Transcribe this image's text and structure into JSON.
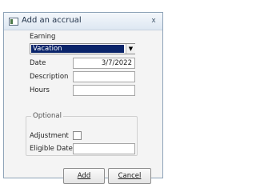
{
  "window": {
    "title": "Add an accrual",
    "close_glyph": "x"
  },
  "earning": {
    "label": "Earning",
    "value": "Vacation",
    "arrow_glyph": "▼"
  },
  "date": {
    "label": "Date",
    "value": "3/7/2022"
  },
  "description": {
    "label": "Description",
    "value": ""
  },
  "hours": {
    "label": "Hours",
    "value": ""
  },
  "optional": {
    "title": "Optional",
    "adjustment_label": "Adjustment",
    "adjustment_checked": false,
    "eligible_date_label": "Eligible Date",
    "eligible_date_value": ""
  },
  "buttons": {
    "add": "Add",
    "cancel": "Cancel"
  },
  "colors": {
    "selection": "#0a246a",
    "accent": "#4d7a4a"
  },
  "icons": {
    "window": "app-window-icon",
    "close": "close-icon",
    "dropdown": "chevron-down-icon"
  }
}
